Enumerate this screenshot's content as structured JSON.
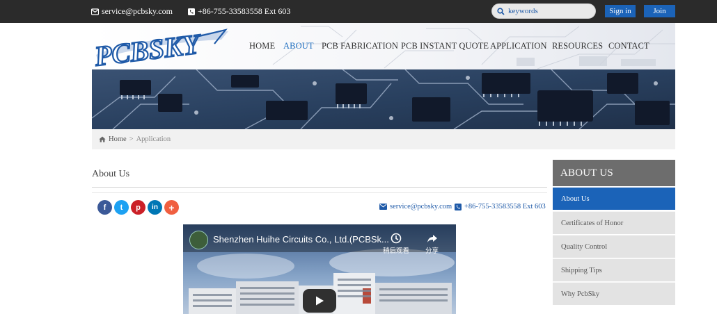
{
  "topbar": {
    "email": "service@pcbsky.com",
    "phone": "+86-755-33583558 Ext 603",
    "search_placeholder": "keywords",
    "signin_label": "Sign in",
    "join_label": "Join"
  },
  "header": {
    "logo_text": "PCBSKY",
    "nav": [
      {
        "label": "HOME",
        "active": false
      },
      {
        "label": "ABOUT",
        "active": true
      },
      {
        "label": "PCB FABRICATION",
        "active": false
      },
      {
        "label": "PCB INSTANT QUOTE",
        "active": false
      },
      {
        "label": "APPLICATION",
        "active": false
      },
      {
        "label": "RESOURCES",
        "active": false
      },
      {
        "label": "CONTACT",
        "active": false
      }
    ]
  },
  "breadcrumb": {
    "home": "Home",
    "separator": ">",
    "current": "Application"
  },
  "main": {
    "title": "About Us",
    "social": [
      {
        "icon": "facebook-icon",
        "glyph": "f",
        "color": "#3b5998"
      },
      {
        "icon": "twitter-icon",
        "glyph": "t",
        "color": "#1da1f2"
      },
      {
        "icon": "pinterest-icon",
        "glyph": "p",
        "color": "#cb2027"
      },
      {
        "icon": "linkedin-icon",
        "glyph": "in",
        "color": "#0077b5"
      },
      {
        "icon": "more-share-icon",
        "glyph": "+",
        "color": "#f05f40"
      }
    ],
    "contact_email": "service@pcbsky.com",
    "contact_phone": "+86-755-33583558 Ext 603",
    "video": {
      "title": "Shenzhen Huihe Circuits Co., Ltd.(PCBSk...",
      "watch_later": "稍后观看",
      "share": "分享"
    }
  },
  "sidebar": {
    "heading": "ABOUT US",
    "items": [
      {
        "label": "About Us",
        "active": true
      },
      {
        "label": "Certificates of Honor",
        "active": false
      },
      {
        "label": "Quality Control",
        "active": false
      },
      {
        "label": "Shipping Tips",
        "active": false
      },
      {
        "label": "Why PcbSky",
        "active": false
      }
    ]
  },
  "colors": {
    "accent": "#1b63b8",
    "topbar": "#2b2b2b",
    "sidebar_heading": "#6d6d6d"
  }
}
